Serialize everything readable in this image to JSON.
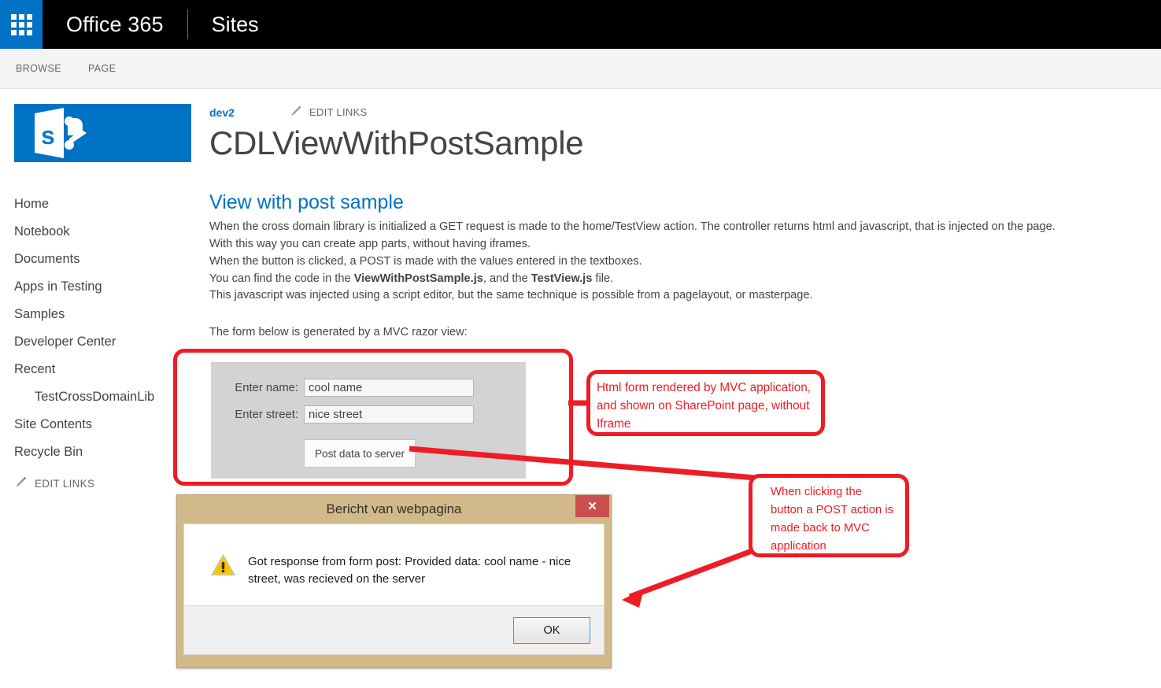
{
  "suite": {
    "app_launcher_icon": "waffle-grid-icon",
    "brand": "Office 365",
    "section": "Sites"
  },
  "ribbon": {
    "tabs": [
      "BROWSE",
      "PAGE"
    ]
  },
  "sidebar": {
    "logo_icon": "sharepoint-logo-icon",
    "items": [
      {
        "label": "Home",
        "child": false
      },
      {
        "label": "Notebook",
        "child": false
      },
      {
        "label": "Documents",
        "child": false
      },
      {
        "label": "Apps in Testing",
        "child": false
      },
      {
        "label": "Samples",
        "child": false
      },
      {
        "label": "Developer Center",
        "child": false
      },
      {
        "label": "Recent",
        "child": false
      },
      {
        "label": "TestCrossDomainLib",
        "child": true
      },
      {
        "label": "Site Contents",
        "child": false
      },
      {
        "label": "Recycle Bin",
        "child": false
      }
    ],
    "edit_links_label": "EDIT LINKS",
    "edit_links_icon": "pencil-icon"
  },
  "header": {
    "breadcrumb_site": "dev2",
    "edit_links_label": "EDIT LINKS",
    "edit_links_icon": "pencil-icon",
    "page_title": "CDLViewWithPostSample"
  },
  "main": {
    "section_heading": "View with post sample",
    "body_lines": [
      "When the cross domain library is initialized a GET request is made to the home/TestView action. The controller returns html and javascript, that is injected on the page.",
      "With this way you can create app parts, without having iframes.",
      "When the button is clicked, a POST is made with the values entered in the textboxes.",
      "You can find the code in the ViewWithPostSample.js, and the TestView.js file.",
      "This javascript was injected using a script editor, but the same technique is possible from a pagelayout, or masterpage."
    ],
    "bold_terms": [
      "ViewWithPostSample.js",
      "TestView.js"
    ],
    "form_intro": "The form below is generated by a MVC razor view:"
  },
  "form": {
    "name_label": "Enter name:",
    "name_value": "cool name",
    "street_label": "Enter street:",
    "street_value": "nice street",
    "submit_label": "Post data to server",
    "background_color": "#d3d3d3"
  },
  "annotations": {
    "color": "#ee1c25",
    "callout_1": [
      "Html form rendered by MVC application,",
      "and shown on SharePoint page, without",
      "Iframe"
    ],
    "callout_2": [
      "When clicking the",
      "button a POST action is",
      "made back to MVC",
      "application"
    ]
  },
  "dialog": {
    "title": "Bericht van webpagina",
    "close_label": "✕",
    "close_icon": "close-icon",
    "warning_icon": "warning-triangle-icon",
    "message": "Got response from form post: Provided data: cool name - nice street, was recieved on the server",
    "ok_label": "OK",
    "titlebar_color": "#d2b989",
    "close_button_color": "#c9504f"
  }
}
